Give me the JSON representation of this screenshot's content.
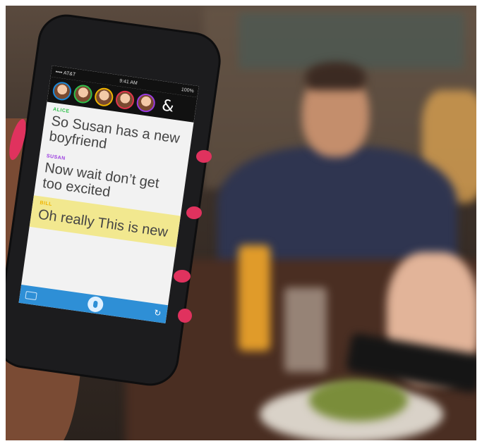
{
  "phone": {
    "status": {
      "carrier": "•••• AT&T",
      "time": "9:41 AM",
      "battery": "100%"
    },
    "amp_symbol": "&",
    "avatars": [
      {
        "name": "avatar-1",
        "ring": "#1b88d8"
      },
      {
        "name": "avatar-2",
        "ring": "#2fbf4a"
      },
      {
        "name": "avatar-3",
        "ring": "#f0b400"
      },
      {
        "name": "avatar-4",
        "ring": "#e0344b"
      },
      {
        "name": "avatar-5",
        "ring": "#9b3be0"
      }
    ],
    "messages": [
      {
        "speaker": "ALICE",
        "color": "#2fbf4a",
        "text": "So Susan has a new boyfriend"
      },
      {
        "speaker": "SUSAN",
        "color": "#9b3be0",
        "text": "Now wait don’t get too excited"
      },
      {
        "speaker": "BILL",
        "color": "#f0b400",
        "text": "Oh really This is new"
      }
    ]
  },
  "colors": {
    "bar": "#2e8fd6",
    "highlight": "#f2e88f",
    "nail": "#e0325e"
  }
}
